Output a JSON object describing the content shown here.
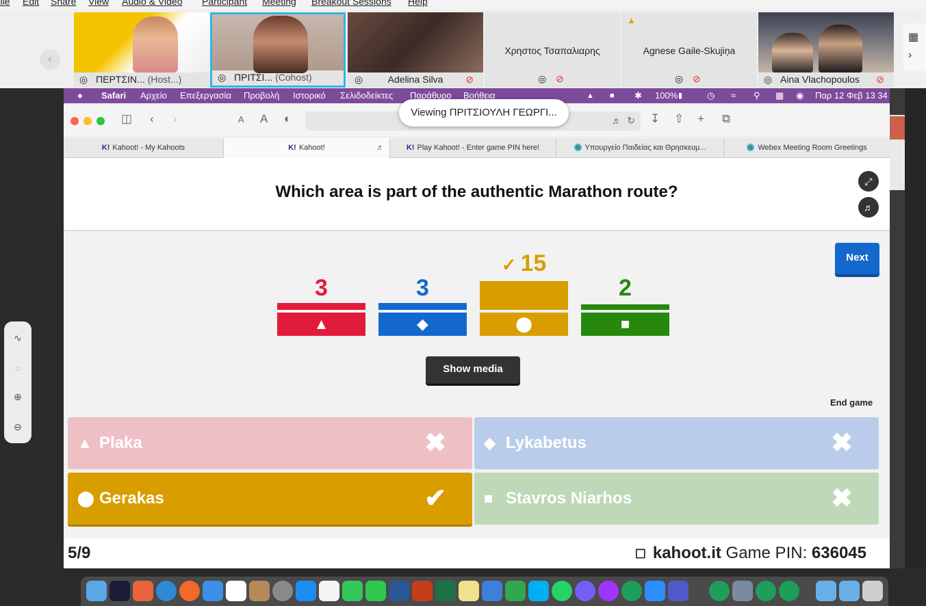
{
  "webex": {
    "menu": [
      "File",
      "Edit",
      "Share",
      "View",
      "Audio & Video",
      "Participant",
      "Meeting",
      "Breakout Sessions",
      "Help"
    ],
    "participants": [
      {
        "name": "ΠΕΡΤΣΙΝ...",
        "role": "(Host...)",
        "muted": false
      },
      {
        "name": "ΠΡΙΤΣΙ...",
        "role": "(Cohost)",
        "muted": false
      },
      {
        "name": "Adelina Silva",
        "role": "",
        "muted": true
      },
      {
        "name": "Χρηστος Τσαπαλιαρης",
        "role": "",
        "muted": true
      },
      {
        "name": "Agnese Gaile-Skujiņa",
        "role": "",
        "muted": true
      },
      {
        "name": "Aina Vlachopoulos",
        "role": "",
        "muted": true
      }
    ]
  },
  "mac_menubar": {
    "items": [
      "Safari",
      "Αρχείο",
      "Επεξεργασία",
      "Προβολή",
      "Ιστορικό",
      "Σελιδοδείκτες",
      "Παράθυρο",
      "Βοήθεια"
    ],
    "battery": "100%",
    "datetime": "Παρ 12 Φεβ 13 34"
  },
  "viewing_badge": "Viewing ΠΡΙΤΣΙΟΥΛΗ ΓΕΩΡΓΙ...",
  "browser": {
    "tabs": [
      {
        "label": "Kahoot! - My Kahoots",
        "icon": "K!"
      },
      {
        "label": "Kahoot!",
        "icon": "K!"
      },
      {
        "label": "Play Kahoot! - Enter game PIN here!",
        "icon": "K!"
      },
      {
        "label": "Υπουργείο Παιδείας και Θρησκευμ...",
        "icon": "globe"
      },
      {
        "label": "Webex Meeting Room Greetings",
        "icon": "globe"
      }
    ]
  },
  "kahoot": {
    "question": "Which area is part of the authentic Marathon route?",
    "next_label": "Next",
    "show_media_label": "Show media",
    "end_game_label": "End game",
    "counter": "5/9",
    "site": "kahoot.it",
    "pin_label": "Game PIN:",
    "pin": "636045",
    "colors": {
      "red": "#e21b3c",
      "blue": "#1368ce",
      "yellow": "#d89e00",
      "green": "#26890c"
    },
    "results": [
      {
        "shape": "triangle",
        "count": "3",
        "color": "#e21b3c",
        "correct": false
      },
      {
        "shape": "diamond",
        "count": "3",
        "color": "#1368ce",
        "correct": false
      },
      {
        "shape": "circle",
        "count": "15",
        "color": "#d89e00",
        "correct": true
      },
      {
        "shape": "square",
        "count": "2",
        "color": "#26890c",
        "correct": false
      }
    ],
    "answers": [
      {
        "label": "Plaka",
        "shape": "triangle",
        "correct": false
      },
      {
        "label": "Lykabetus",
        "shape": "diamond",
        "correct": false
      },
      {
        "label": "Gerakas",
        "shape": "circle",
        "correct": true
      },
      {
        "label": "Stavros Niarhos",
        "shape": "square",
        "correct": false
      }
    ]
  }
}
